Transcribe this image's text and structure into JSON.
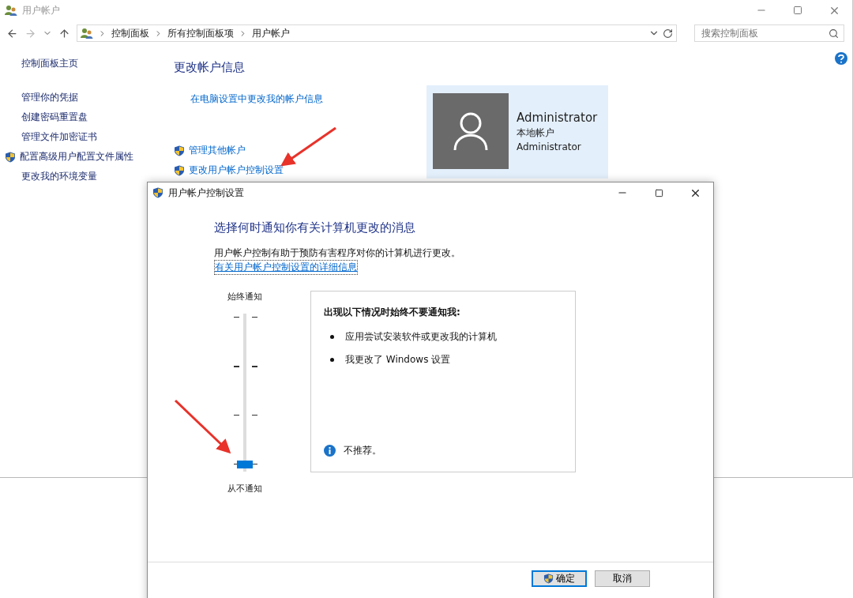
{
  "window": {
    "title": "用户帐户"
  },
  "breadcrumbs": [
    "控制面板",
    "所有控制面板项",
    "用户帐户"
  ],
  "search": {
    "placeholder": "搜索控制面板"
  },
  "sidebar": {
    "items": [
      {
        "label": "控制面板主页",
        "shield": false
      },
      {
        "label": "管理你的凭据",
        "shield": false
      },
      {
        "label": "创建密码重置盘",
        "shield": false
      },
      {
        "label": "管理文件加密证书",
        "shield": false
      },
      {
        "label": "配置高级用户配置文件属性",
        "shield": true
      },
      {
        "label": "更改我的环境变量",
        "shield": false
      }
    ]
  },
  "main": {
    "heading": "更改帐户信息",
    "links": [
      {
        "label": "在电脑设置中更改我的帐户信息",
        "shield": false
      },
      {
        "label": "管理其他帐户",
        "shield": true
      },
      {
        "label": "更改用户帐户控制设置",
        "shield": true
      }
    ]
  },
  "account": {
    "name": "Administrator",
    "type": "本地帐户",
    "username": "Administrator"
  },
  "dialog": {
    "title": "用户帐户控制设置",
    "heading": "选择何时通知你有关计算机更改的消息",
    "description": "用户帐户控制有助于预防有害程序对你的计算机进行更改。",
    "link": "有关用户帐户控制设置的详细信息",
    "slider": {
      "top_label": "始终通知",
      "bottom_label": "从不通知",
      "level": 0
    },
    "info": {
      "title": "出现以下情况时始终不要通知我:",
      "bullets": [
        "应用尝试安装软件或更改我的计算机",
        "我更改了 Windows 设置"
      ],
      "note": "不推荐。"
    },
    "buttons": [
      {
        "label": "确定",
        "shield": true,
        "default": true
      },
      {
        "label": "取消",
        "shield": false,
        "default": false
      }
    ]
  }
}
